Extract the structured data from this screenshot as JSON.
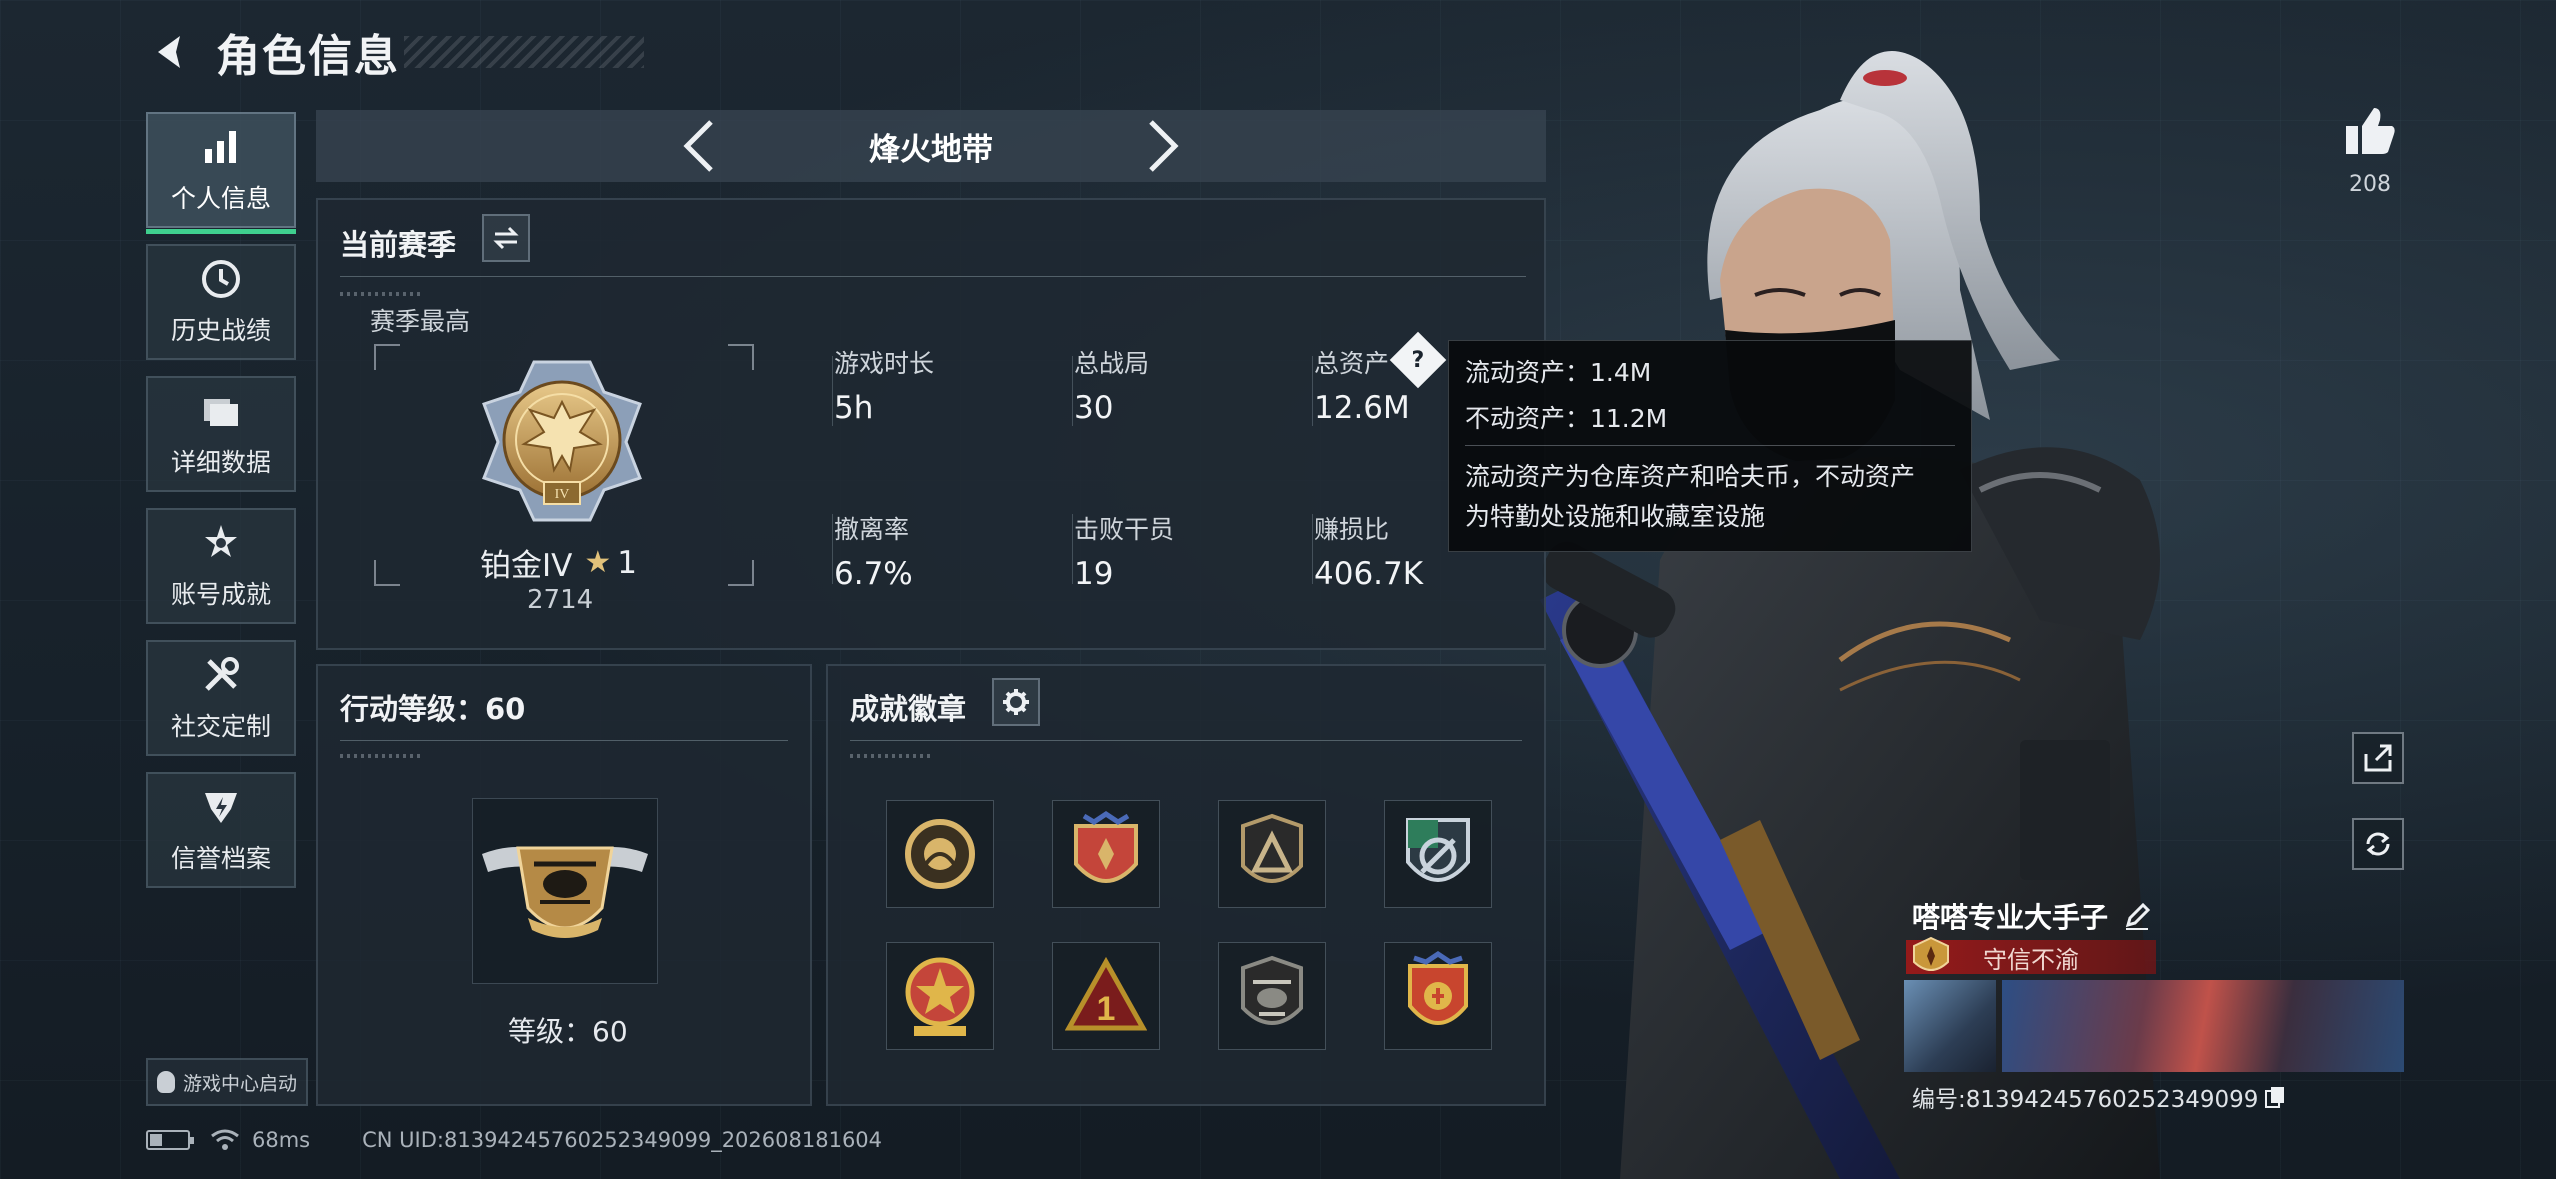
{
  "header": {
    "title": "角色信息",
    "back_icon": "chevron-left-icon"
  },
  "sidebar": {
    "items": [
      {
        "label": "个人信息",
        "icon": "bar-chart-icon",
        "active": true
      },
      {
        "label": "历史战绩",
        "icon": "clock-icon"
      },
      {
        "label": "详细数据",
        "icon": "folder-icon"
      },
      {
        "label": "账号成就",
        "icon": "achievement-star-icon"
      },
      {
        "label": "社交定制",
        "icon": "tools-icon"
      },
      {
        "label": "信誉档案",
        "icon": "shield-lightning-icon"
      }
    ],
    "launch_label": "游戏中心启动"
  },
  "mode_selector": {
    "name": "烽火地带"
  },
  "season": {
    "title": "当前赛季",
    "best_label": "赛季最高",
    "rank_name": "铂金IV",
    "rank_star": "★",
    "rank_star_count": "1",
    "rank_score": "2714",
    "stats": [
      {
        "label": "游戏时长",
        "value": "5h"
      },
      {
        "label": "总战局",
        "value": "30"
      },
      {
        "label": "总资产",
        "value": "12.6M"
      },
      {
        "label": "撤离率",
        "value": "6.7%"
      },
      {
        "label": "击败干员",
        "value": "19"
      },
      {
        "label": "赚损比",
        "value": "406.7K"
      }
    ],
    "help_glyph": "?"
  },
  "tooltip": {
    "liquid": "流动资产：1.4M",
    "fixed": "不动资产：11.2M",
    "desc_line1": "流动资产为仓库资产和哈夫币，不动资产",
    "desc_line2": "为特勤处设施和收藏室设施"
  },
  "action_level": {
    "title": "行动等级：60",
    "level_text": "等级：60",
    "medal_icon": "helicopter-wing-medal-icon"
  },
  "achievements": {
    "title": "成就徽章",
    "badges": [
      {
        "icon": "round-coin-badge-icon",
        "colors": [
          "#d9b56a",
          "#3a3020"
        ]
      },
      {
        "icon": "crest-shield-badge-icon",
        "colors": [
          "#c4453a",
          "#d9b56a"
        ]
      },
      {
        "icon": "triangle-badge-icon",
        "colors": [
          "#b39a6a",
          "#2a2a2a"
        ]
      },
      {
        "icon": "green-shield-badge-icon",
        "colors": [
          "#2e7d5b",
          "#c9d3dc"
        ]
      },
      {
        "icon": "star-medal-badge-icon",
        "colors": [
          "#c4453a",
          "#e0b64a"
        ]
      },
      {
        "icon": "number-one-badge-icon",
        "colors": [
          "#b8902a",
          "#7a1c1c"
        ]
      },
      {
        "icon": "helicopter-badge-icon",
        "colors": [
          "#8a8a84",
          "#2a2a2a"
        ]
      },
      {
        "icon": "red-crest-badge-icon",
        "colors": [
          "#c8452e",
          "#e0b64a"
        ]
      }
    ]
  },
  "social": {
    "like_count": "208",
    "like_icon": "thumbs-up-icon",
    "share_icon": "share-icon",
    "refresh_icon": "refresh-icon"
  },
  "player": {
    "name": "嗒嗒专业大手子",
    "honor_title": "守信不渝",
    "id_text": "编号:81394245760252349099",
    "edit_icon": "pencil-icon",
    "copy_icon": "copy-icon"
  },
  "status_bar": {
    "ping": "68ms",
    "uid": "CN UID:81394245760252349099_202608181604"
  },
  "colors": {
    "accent": "#3fcf8e",
    "honor_red": "#9b1919",
    "medal_gold": "#c9a45c"
  }
}
